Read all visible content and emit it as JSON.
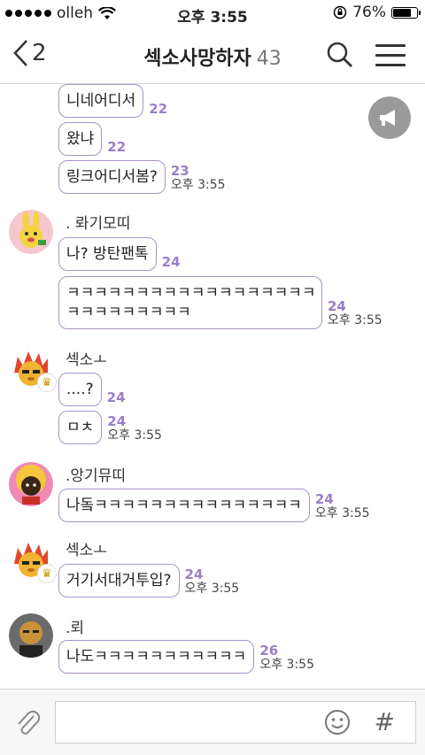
{
  "status": {
    "carrier": "olleh",
    "time": "오후 3:55",
    "battery": "76%",
    "battery_level": 0.76
  },
  "header": {
    "back_count": "2",
    "title": "섹소사망하자",
    "member_count": "43"
  },
  "messages": [
    {
      "type": "bubble",
      "text": "니네어디서",
      "unread": "22",
      "time": ""
    },
    {
      "type": "bubble",
      "text": "왔냐",
      "unread": "22",
      "time": ""
    },
    {
      "type": "bubble",
      "text": "링크어디서봄?",
      "unread": "23",
      "time": "오후 3:55"
    },
    {
      "type": "sender",
      "name": ". 롸기모띠"
    },
    {
      "type": "bubble",
      "text": "나?  방탄팬톡",
      "unread": "24",
      "time": ""
    },
    {
      "type": "bubble",
      "text_line1": "ㅋㅋㅋㅋㅋㅋㅋㅋㅋㅋㅋㅋㅋㅋㅋㅋㅋㅋㅋㅋ",
      "text_line2": "ㅋㅋㅋㅋㅋㅋㅋㅋㅋ",
      "unread": "24",
      "time": "오후 3:55"
    },
    {
      "type": "sender",
      "name": "섹소ㅗ"
    },
    {
      "type": "bubble",
      "text": "....?",
      "unread": "24",
      "time": ""
    },
    {
      "type": "bubble",
      "text": "ㅁㅊ",
      "unread": "24",
      "time": "오후 3:55"
    },
    {
      "type": "sender",
      "name": ".앙기뮤띠"
    },
    {
      "type": "bubble",
      "text": "나돜ㅋㅋㅋㅋㅋㅋㅋㅋㅋㅋㅋㅋㅋㅋㅋ",
      "unread": "24",
      "time": "오후 3:55"
    },
    {
      "type": "sender",
      "name": "섹소ㅗ"
    },
    {
      "type": "bubble",
      "text": "거기서대거투입?",
      "unread": "24",
      "time": "오후 3:55"
    },
    {
      "type": "sender",
      "name": ".뢰"
    },
    {
      "type": "bubble",
      "text": "나도ㅋㅋㅋㅋㅋㅋㅋㅋㅋㅋㅋ",
      "unread": "26",
      "time": "오후 3:55"
    }
  ],
  "icons": {
    "back": "chevron-left-icon",
    "search": "search-icon",
    "menu": "hamburger-menu-icon",
    "notice": "megaphone-icon",
    "attach": "paperclip-icon",
    "emoji": "smiley-icon",
    "hash": "hash-icon"
  },
  "input": {
    "hash_symbol": "#"
  },
  "colors": {
    "bubble_border": "#a894c6",
    "unread": "#9a7fc6"
  }
}
